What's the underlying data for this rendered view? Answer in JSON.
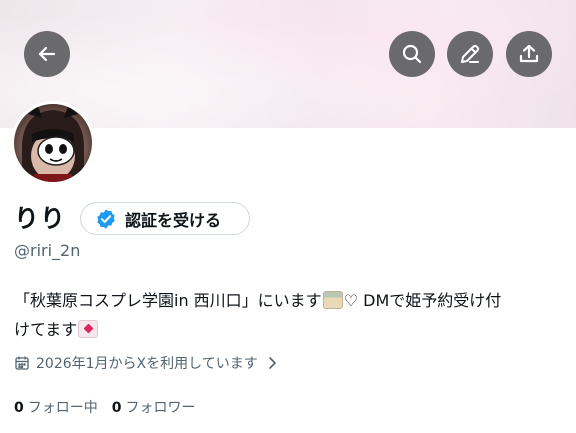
{
  "header": {
    "back_icon": "arrow-left-icon",
    "search_icon": "search-icon",
    "edit_icon": "pencil-icon",
    "share_icon": "share-icon",
    "button_color": "#6a6a6c"
  },
  "profile": {
    "display_name": "りり",
    "handle": "@riri_2n",
    "verify_label": "認証を受ける",
    "verify_icon": "verified-badge-icon",
    "accent_color": "#1d9bf0",
    "bio_line1_a": "「秋葉原コスプレ学園in 西川口」にいます",
    "bio_line1_b": "♡ DMで姫予約受け付",
    "bio_line2": "けてます",
    "bio_emoji_1": "school-emoji-icon",
    "bio_emoji_2": "love-letter-emoji-icon",
    "joined_text": "2026年1月からXを利用しています",
    "joined_icon": "calendar-icon"
  },
  "stats": {
    "following_count": "0",
    "following_label": "フォロー中",
    "followers_count": "0",
    "followers_label": "フォロワー"
  }
}
